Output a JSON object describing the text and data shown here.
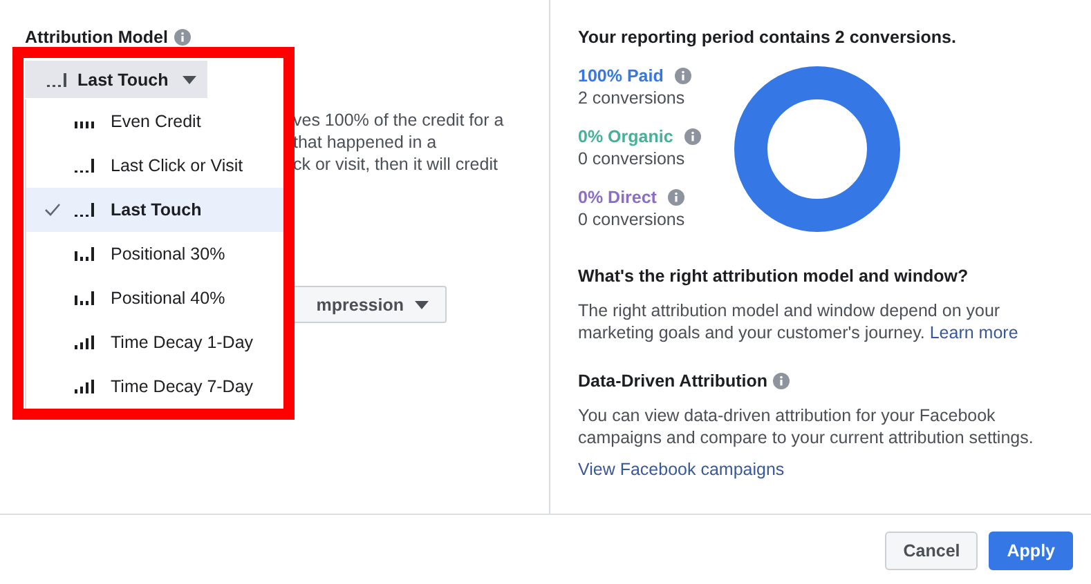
{
  "attribution_model": {
    "title": "Attribution Model",
    "dropdown": {
      "label": "Last Touch",
      "kind": "last"
    },
    "menu": [
      {
        "label": "Even Credit",
        "kind": "even",
        "selected": false
      },
      {
        "label": "Last Click or Visit",
        "kind": "last",
        "selected": false
      },
      {
        "label": "Last Touch",
        "kind": "last",
        "selected": true
      },
      {
        "label": "Positional 30%",
        "kind": "positional",
        "selected": false
      },
      {
        "label": "Positional 40%",
        "kind": "positional",
        "selected": false
      },
      {
        "label": "Time Decay 1-Day",
        "kind": "decay",
        "selected": false
      },
      {
        "label": "Time Decay 7-Day",
        "kind": "decay",
        "selected": false
      }
    ],
    "description_lines": [
      "ves 100% of the credit for a",
      "that happened in a",
      "ck or visit, then it will credit"
    ],
    "window_dropdown": {
      "label": "mpression"
    }
  },
  "summary": {
    "title": "Your reporting period contains 2 conversions.",
    "legend": [
      {
        "label": "100% Paid",
        "count": "2 conversions",
        "color": "#3578e5"
      },
      {
        "label": "0% Organic",
        "count": "0 conversions",
        "color": "#42b39a"
      },
      {
        "label": "0% Direct",
        "count": "0 conversions",
        "color": "#8c6cc9"
      }
    ]
  },
  "help": [
    {
      "title": "What's the right attribution model and window?",
      "text": "The right attribution model and window depend on your marketing goals and your customer's journey.",
      "link": "Learn more",
      "info": false
    },
    {
      "title": "Data-Driven Attribution",
      "text": "You can view data-driven attribution for your Facebook campaigns and compare to your current attribution settings.",
      "link": "View Facebook campaigns",
      "info": true
    }
  ],
  "buttons": [
    {
      "label": "Cancel",
      "kind": "secondary"
    },
    {
      "label": "Apply",
      "kind": "primary"
    }
  ]
}
